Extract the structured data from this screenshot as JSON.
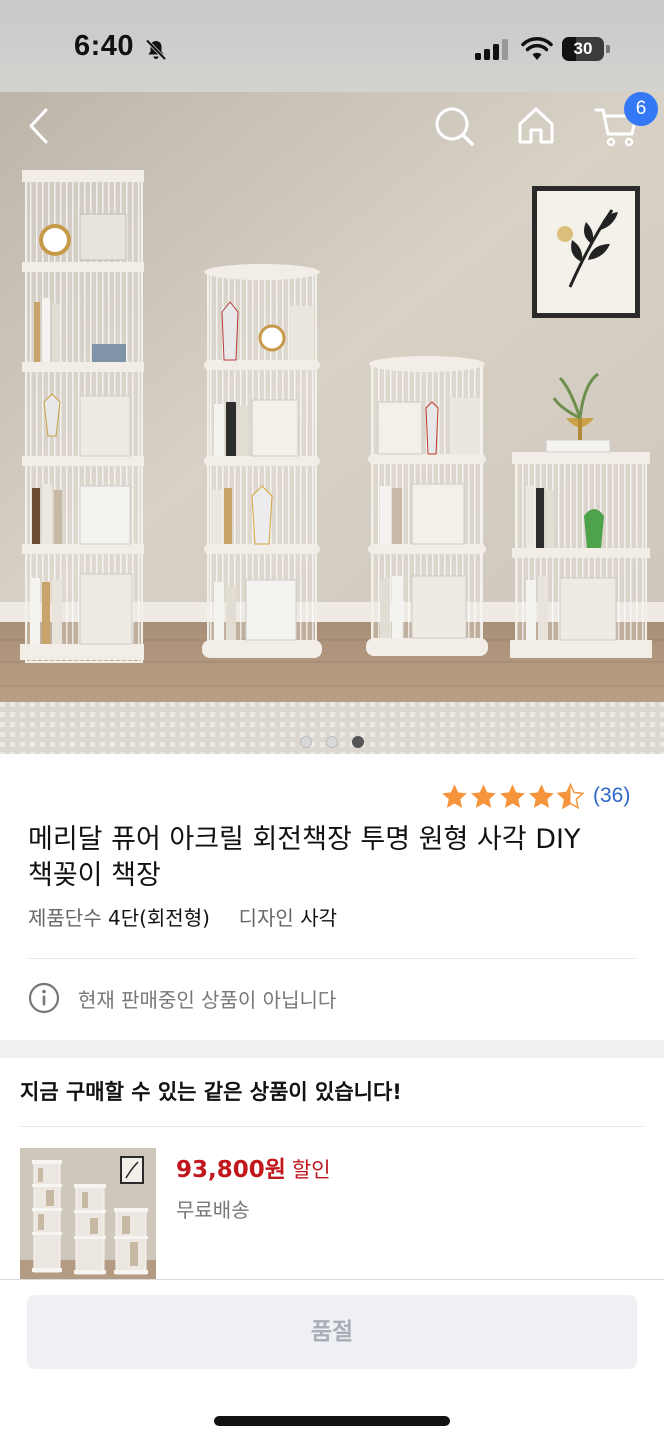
{
  "status_bar": {
    "time": "6:40",
    "battery": "30",
    "icons": [
      "bell-slash-icon",
      "signal-icon",
      "wifi-icon",
      "battery-icon"
    ]
  },
  "nav": {
    "icons": [
      "back-icon",
      "search-icon",
      "home-icon",
      "cart-icon"
    ],
    "cart_count": "6"
  },
  "gallery": {
    "total_images": 3,
    "active_index": 3
  },
  "product": {
    "rating": 4.5,
    "review_count": "(36)",
    "title": "메리달 퓨어 아크릴 회전책장 투명 원형 사각 DIY 책꽂이 책장",
    "options": [
      {
        "key": "제품단수",
        "value": "4단(회전형)"
      },
      {
        "key": "디자인",
        "value": "사각"
      }
    ],
    "notice": "현재 판매중인 상품이 아닙니다"
  },
  "alternative": {
    "heading": "지금 구매할 수 있는 같은 상품이 있습니다!",
    "price": "93,800원",
    "discount_label": "할인",
    "shipping": "무료배송"
  },
  "bottom": {
    "button_label": "품절"
  },
  "colors": {
    "accent_blue": "#3478f6",
    "link_blue": "#2e66c7",
    "price_red": "#c0161c",
    "star_orange": "#f5943a"
  }
}
